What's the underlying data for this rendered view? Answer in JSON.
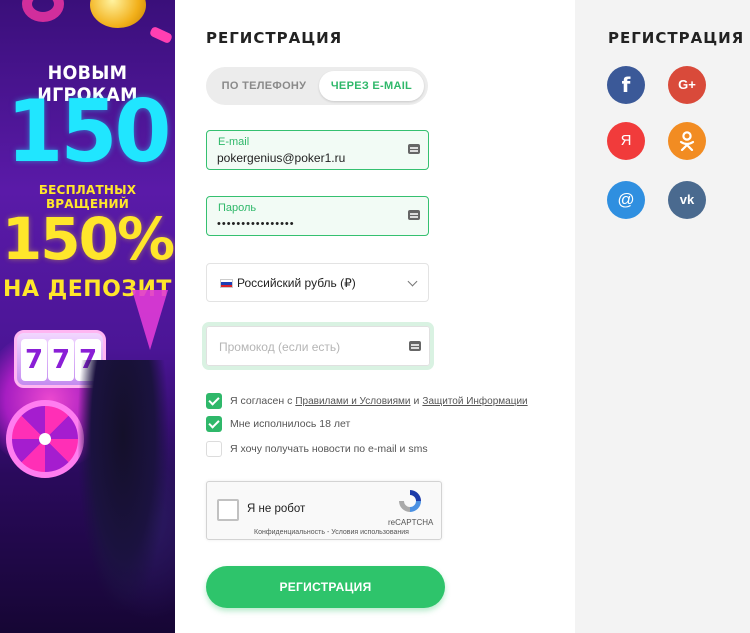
{
  "banner": {
    "line1": "НОВЫМ ИГРОКАМ",
    "big_number": "150",
    "free_spins": "БЕСПЛАТНЫХ ВРАЩЕНИЙ",
    "percent": "150%",
    "deposit": "НА ДЕПОЗИТ",
    "slot_digits": [
      "7",
      "7",
      "7"
    ]
  },
  "form": {
    "title": "РЕГИСТРАЦИЯ",
    "tabs": [
      {
        "label": "ПО ТЕЛЕФОНУ",
        "active": false
      },
      {
        "label": "ЧЕРЕЗ E-MAIL",
        "active": true
      }
    ],
    "email": {
      "label": "E-mail",
      "value": "pokergenius@poker1.ru"
    },
    "password": {
      "label": "Пароль",
      "value": "••••••••••••••••"
    },
    "currency": {
      "value": "Российский рубль (₽)",
      "flag": "russia-flag"
    },
    "promo": {
      "placeholder": "Промокод (если есть)",
      "value": ""
    },
    "checkboxes": [
      {
        "checked": true,
        "text_before": "Я согласен с",
        "link1": "Правилами и Условиями",
        "middle": "и",
        "link2": "Защитой Информации"
      },
      {
        "checked": true,
        "text": "Мне исполнилось 18 лет"
      },
      {
        "checked": false,
        "text": "Я хочу получать новости по e-mail и sms"
      }
    ],
    "recaptcha": {
      "label": "Я не робот",
      "brand": "reCAPTCHA",
      "links": "Конфиденциальность - Условия использования"
    },
    "submit": "РЕГИСТРАЦИЯ"
  },
  "social": {
    "title": "РЕГИСТРАЦИЯ",
    "buttons": [
      {
        "name": "facebook",
        "glyph": "f",
        "color": "#3b5998"
      },
      {
        "name": "google-plus",
        "glyph": "G+",
        "color": "#d94a3a"
      },
      {
        "name": "yandex",
        "glyph": "Я",
        "color": "#f13b3b"
      },
      {
        "name": "odnoklassniki",
        "glyph": "ok",
        "color": "#f28c22"
      },
      {
        "name": "mail-ru",
        "glyph": "@",
        "color": "#2f8fe0"
      },
      {
        "name": "vkontakte",
        "glyph": "vk",
        "color": "#4a6a8f"
      }
    ]
  },
  "colors": {
    "accent": "#2ec46b",
    "banner_cyan": "#20e6ff",
    "banner_yellow": "#ffe62b"
  }
}
